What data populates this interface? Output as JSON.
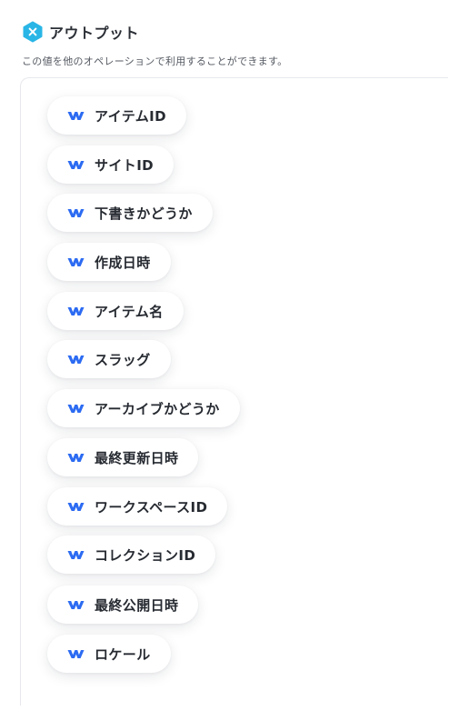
{
  "header": {
    "icon": "hex-x-icon",
    "icon_color": "#29b6e6",
    "title": "アウトプット",
    "description": "この値を他のオペレーションで利用することができます。"
  },
  "outputs": {
    "chip_icon": "webflow-icon",
    "chip_icon_color": "#2c6bf2",
    "items": [
      {
        "label": "アイテムID"
      },
      {
        "label": "サイトID"
      },
      {
        "label": "下書きかどうか"
      },
      {
        "label": "作成日時"
      },
      {
        "label": "アイテム名"
      },
      {
        "label": "スラッグ"
      },
      {
        "label": "アーカイブかどうか"
      },
      {
        "label": "最終更新日時"
      },
      {
        "label": "ワークスペースID"
      },
      {
        "label": "コレクションID"
      },
      {
        "label": "最終公開日時"
      },
      {
        "label": "ロケール"
      }
    ]
  }
}
